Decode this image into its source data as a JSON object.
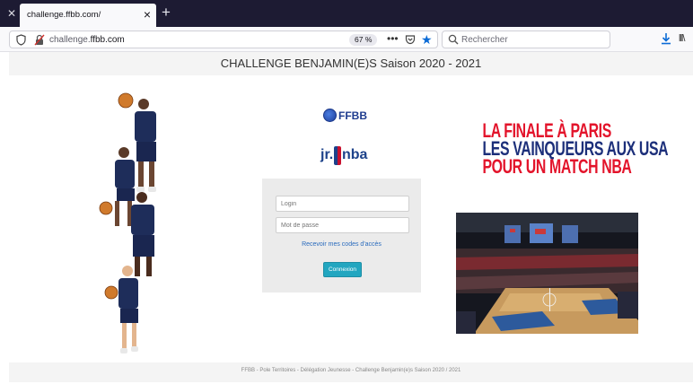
{
  "browser": {
    "tab": {
      "title": "challenge.ffbb.com/"
    },
    "url": {
      "prefix": "challenge.",
      "domain": "ffbb.com"
    },
    "zoom": "67 %",
    "more_label": "•••",
    "search_placeholder": "Rechercher",
    "library_label": "lll\\"
  },
  "page": {
    "header_title": "CHALLENGE BENJAMIN(E)S Saison 2020 - 2021",
    "ffbb_logo_text": "FFBB",
    "jrnba": {
      "jr": "jr.",
      "nba": "nba"
    },
    "login": {
      "login_placeholder": "Login",
      "password_placeholder": "Mot de passe",
      "codes_link": "Recevoir mes codes d'accès",
      "connect_button": "Connexion"
    },
    "promo": {
      "line1": "LA FINALE À PARIS",
      "line2": "LES VAINQUEURS AUX USA",
      "line3": "POUR UN MATCH NBA"
    },
    "footer": "FFBB - Pole Territoires - Délégation Jeunesse - Challenge Benjamin(e)s Saison 2020 / 2021"
  },
  "colors": {
    "tabbar": "#1d1b33",
    "accent_blue": "#0b6bd6",
    "ffbb_blue": "#1f3c8f",
    "nba_blue": "#1d428a",
    "promo_red": "#e3142b",
    "promo_blue": "#1c2f7a",
    "button_teal": "#22a6c0",
    "link_blue": "#2a6bbd"
  },
  "icons": [
    "close-icon",
    "plus-icon",
    "shield-icon",
    "insecure-lock-icon",
    "pocket-icon",
    "star-icon",
    "search-icon",
    "download-icon",
    "library-icon"
  ]
}
